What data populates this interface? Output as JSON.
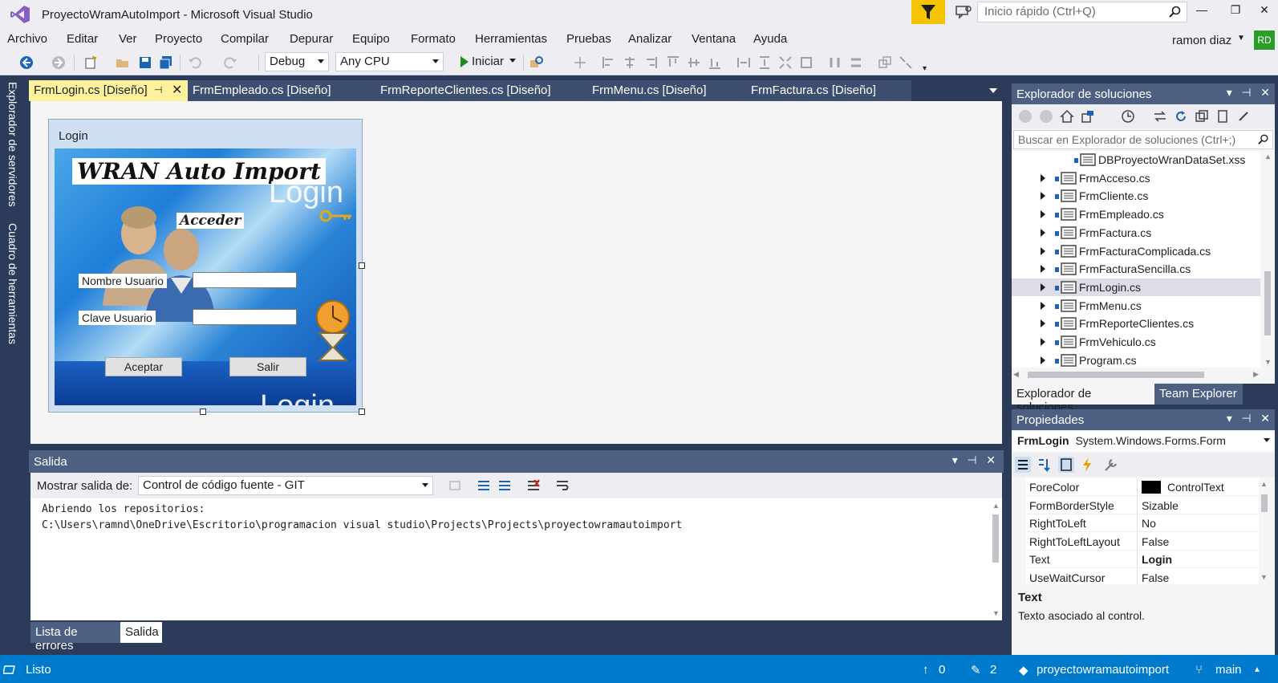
{
  "titlebar": {
    "title": "ProyectoWramAutoImport - Microsoft Visual Studio",
    "quick_launch_placeholder": "Inicio rápido (Ctrl+Q)",
    "minimize": "—",
    "maximize": "❐",
    "close": "✕"
  },
  "menu": {
    "items": [
      "Archivo",
      "Editar",
      "Ver",
      "Proyecto",
      "Compilar",
      "Depurar",
      "Equipo",
      "Formato",
      "Herramientas",
      "Pruebas",
      "Analizar",
      "Ventana",
      "Ayuda"
    ],
    "user": "ramon diaz",
    "avatar": "RD"
  },
  "toolbar": {
    "config": "Debug",
    "platform": "Any CPU",
    "start": "Iniciar"
  },
  "left_dock": {
    "tabs": [
      "Explorador de servidores",
      "Cuadro de herramientas"
    ]
  },
  "doc_tabs": [
    {
      "label": "FrmLogin.cs [Diseño]",
      "active": true
    },
    {
      "label": "FrmEmpleado.cs [Diseño]",
      "active": false
    },
    {
      "label": "FrmReporteClientes.cs [Diseño]",
      "active": false
    },
    {
      "label": "FrmMenu.cs [Diseño]",
      "active": false
    },
    {
      "label": "FrmFactura.cs [Diseño]",
      "active": false
    }
  ],
  "form": {
    "title": "Login",
    "brand": "WRAN Auto Import",
    "login_text": "Login",
    "acceder": "Acceder",
    "user_label": "Nombre Usuario",
    "pass_label": "Clave Usuario",
    "user_value": "",
    "pass_value": "",
    "accept": "Aceptar",
    "exit": "Salir"
  },
  "output": {
    "title": "Salida",
    "show_label": "Mostrar salida de:",
    "source": "Control de código fuente - GIT",
    "lines": [
      "Abriendo los repositorios:",
      "C:\\Users\\ramnd\\OneDrive\\Escritorio\\programacion visual studio\\Projects\\Projects\\proyectowramautoimport"
    ],
    "tabs": [
      "Lista de errores",
      "Salida"
    ]
  },
  "solution_explorer": {
    "title": "Explorador de soluciones",
    "search_placeholder": "Buscar en Explorador de soluciones (Ctrl+;)",
    "items": [
      {
        "name": "DBProyectoWranDataSet.xss",
        "expandable": false,
        "selected": false
      },
      {
        "name": "FrmAcceso.cs",
        "expandable": true,
        "selected": false
      },
      {
        "name": "FrmCliente.cs",
        "expandable": true,
        "selected": false
      },
      {
        "name": "FrmEmpleado.cs",
        "expandable": true,
        "selected": false
      },
      {
        "name": "FrmFactura.cs",
        "expandable": true,
        "selected": false
      },
      {
        "name": "FrmFacturaComplicada.cs",
        "expandable": true,
        "selected": false
      },
      {
        "name": "FrmFacturaSencilla.cs",
        "expandable": true,
        "selected": false
      },
      {
        "name": "FrmLogin.cs",
        "expandable": true,
        "selected": true
      },
      {
        "name": "FrmMenu.cs",
        "expandable": true,
        "selected": false
      },
      {
        "name": "FrmReporteClientes.cs",
        "expandable": true,
        "selected": false
      },
      {
        "name": "FrmVehiculo.cs",
        "expandable": true,
        "selected": false
      },
      {
        "name": "Program.cs",
        "expandable": true,
        "selected": false
      }
    ],
    "tabs": [
      "Explorador de soluciones",
      "Team Explorer"
    ]
  },
  "properties": {
    "title": "Propiedades",
    "object_name": "FrmLogin",
    "object_type": "System.Windows.Forms.Form",
    "rows": [
      {
        "name": "ForeColor",
        "value": "ControlText",
        "swatch": "#000000"
      },
      {
        "name": "FormBorderStyle",
        "value": "Sizable"
      },
      {
        "name": "RightToLeft",
        "value": "No"
      },
      {
        "name": "RightToLeftLayout",
        "value": "False"
      },
      {
        "name": "Text",
        "value": "Login",
        "bold": true
      },
      {
        "name": "UseWaitCursor",
        "value": "False"
      }
    ],
    "desc_title": "Text",
    "desc_text": "Texto asociado al control."
  },
  "status": {
    "ready": "Listo",
    "up_count": "0",
    "pending_count": "2",
    "repo": "proyectowramautoimport",
    "branch": "main"
  },
  "colors": {
    "accent": "#007acc",
    "chrome_dark": "#2d3b5a",
    "active_tab": "#fff29d",
    "filter": "#f5c400"
  }
}
